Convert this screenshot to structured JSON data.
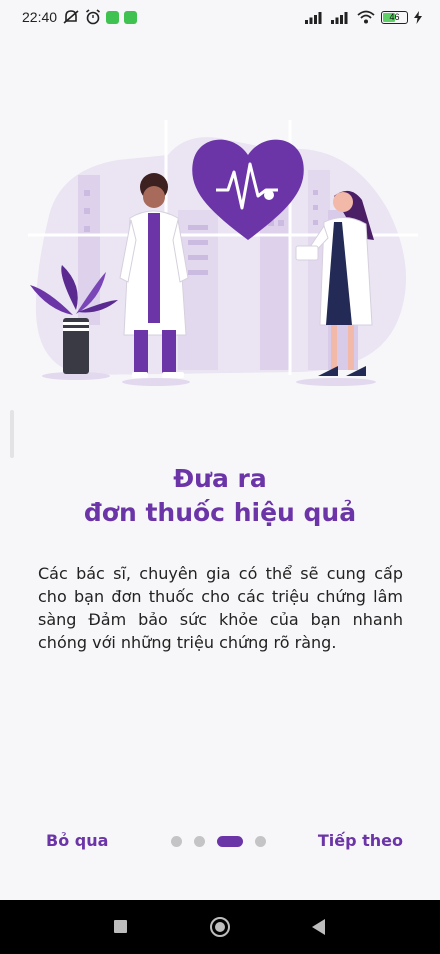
{
  "status_bar": {
    "time": "22:40",
    "battery": "46",
    "icons": [
      "mute-icon",
      "alarm-icon",
      "app-icon",
      "app-icon",
      "signal-icon",
      "signal-icon",
      "wifi-icon",
      "battery-icon",
      "charging-icon"
    ]
  },
  "onboarding": {
    "title_line1": "Đưa ra",
    "title_line2": "đơn thuốc hiệu quả",
    "description": "Các bác sĩ, chuyên gia có thể sẽ cung cấp cho bạn đơn thuốc cho các triệu chứng lâm sàng Đảm bảo sức khỏe của bạn nhanh chóng với những triệu chứng rõ ràng."
  },
  "footer": {
    "skip_label": "Bỏ qua",
    "next_label": "Tiếp theo",
    "page_count": 4,
    "active_page": 3
  },
  "colors": {
    "accent": "#6b35a8",
    "dot_inactive": "#c4c4c6",
    "background": "#f7f7f9"
  }
}
